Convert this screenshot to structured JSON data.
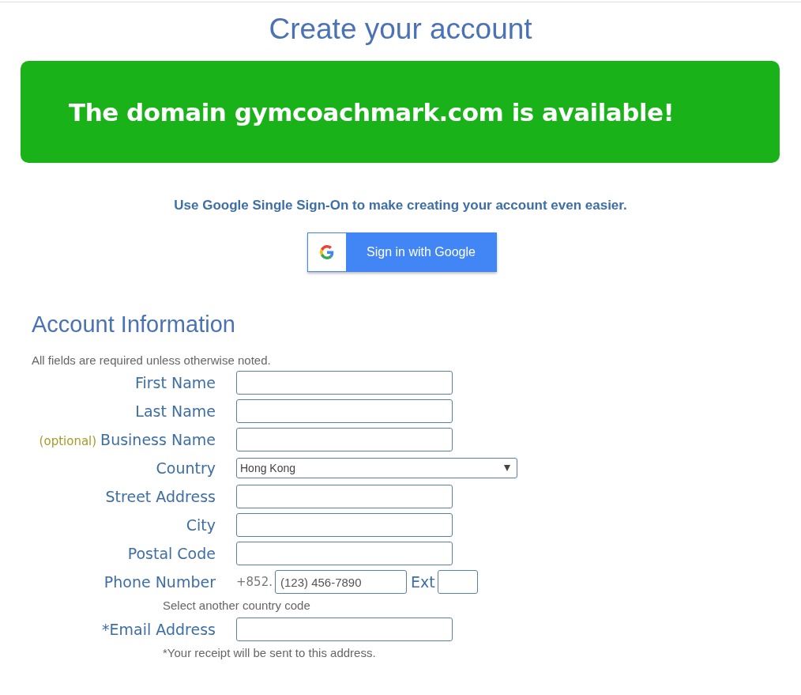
{
  "title": "Create your account",
  "banner": {
    "message": "The domain gymcoachmark.com is available!"
  },
  "sso": {
    "prompt": "Use Google Single Sign-On to make creating your account even easier.",
    "button": "Sign in with Google"
  },
  "section": {
    "heading": "Account Information",
    "note": "All fields are required unless otherwise noted."
  },
  "fields": [
    {
      "kind": "text",
      "label": "First Name"
    },
    {
      "kind": "text",
      "label": "Last Name"
    },
    {
      "kind": "text",
      "label": "Business Name",
      "tag": "(optional)"
    },
    {
      "kind": "select",
      "label": "Country",
      "value": "Hong Kong"
    },
    {
      "kind": "text",
      "label": "Street Address"
    },
    {
      "kind": "text",
      "label": "City"
    },
    {
      "kind": "text",
      "label": "Postal Code"
    },
    {
      "kind": "phone",
      "label": "Phone Number",
      "prefix": "+852.",
      "placeholder": "(123) 456-7890",
      "ext_label": "Ext",
      "link": "Select another country code"
    },
    {
      "kind": "text",
      "label": "*Email Address",
      "hint": "*Your receipt will be sent to this address."
    }
  ]
}
